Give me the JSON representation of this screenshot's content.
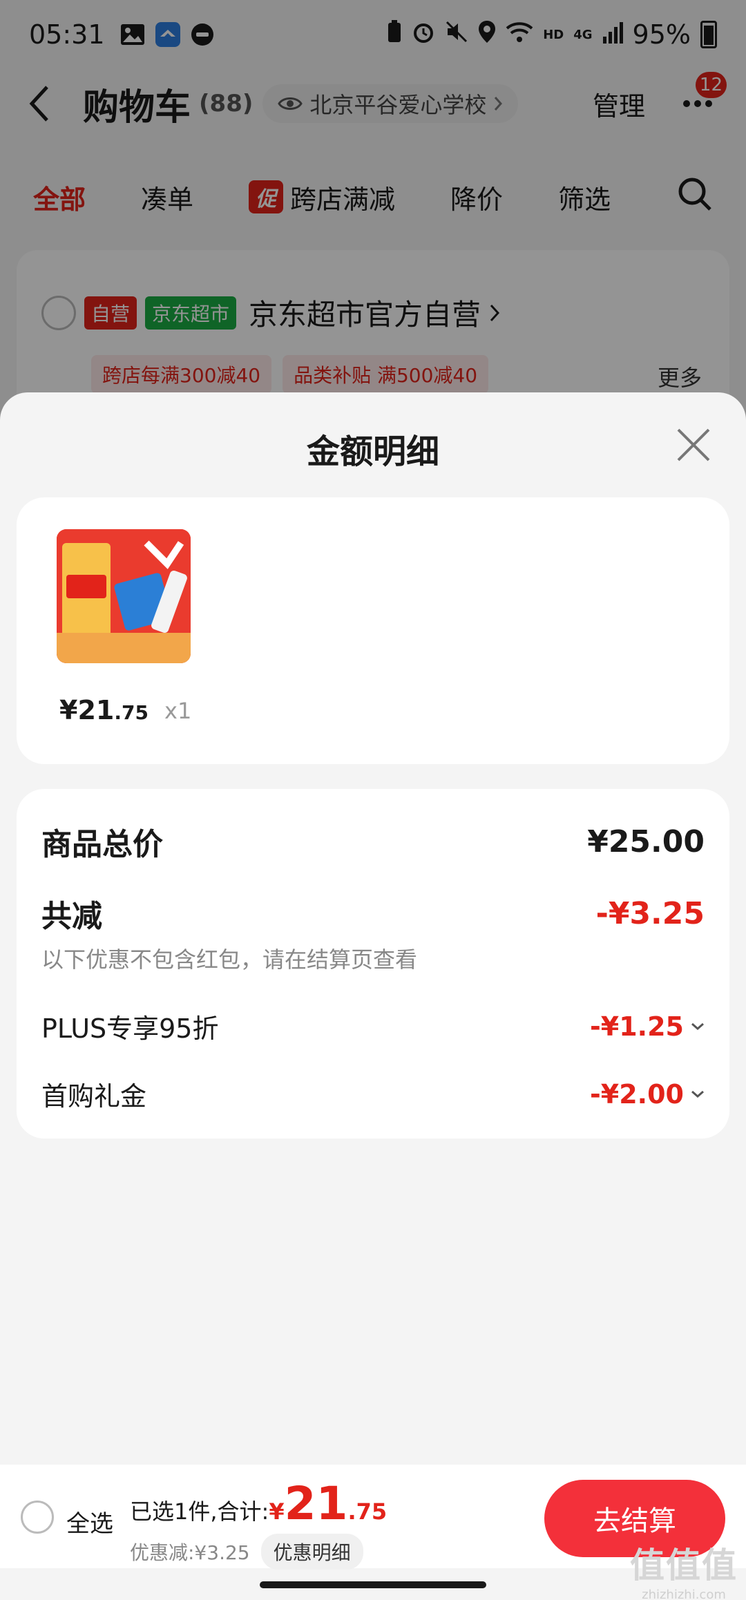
{
  "status_bar": {
    "time": "05:31",
    "network": "HD",
    "signal_label": "4G",
    "battery": "95%"
  },
  "header": {
    "title": "购物车",
    "count": "(88)",
    "location": "北京平谷爱心学校",
    "manage": "管理",
    "badge": "12"
  },
  "tabs": [
    {
      "label": "全部",
      "active": true
    },
    {
      "label": "凑单"
    },
    {
      "label": "跨店满减",
      "tag": "促"
    },
    {
      "label": "降价"
    },
    {
      "label": "筛选"
    }
  ],
  "store": {
    "tag_self": "自营",
    "tag_market": "京东超市",
    "name": "京东超市官方自营",
    "promo1": "跨店每满300减40",
    "promo2": "品类补贴 满500减40",
    "more": "更多"
  },
  "sheet": {
    "title": "金额明细",
    "product": {
      "price_int": "¥21",
      "price_dec": ".75",
      "qty": "x1"
    },
    "rows": {
      "subtotal_label": "商品总价",
      "subtotal_value": "¥25.00",
      "discount_label": "共减",
      "discount_value": "-¥3.25",
      "note": "以下优惠不包含红包，请在结算页查看",
      "plus_label": "PLUS专享95折",
      "plus_value": "-¥1.25",
      "gift_label": "首购礼金",
      "gift_value": "-¥2.00"
    }
  },
  "bottom": {
    "select_all": "全选",
    "summary": "已选1件,合计:",
    "total_cur": "¥",
    "total_int": "21",
    "total_dec": ".75",
    "discount": "优惠减:¥3.25",
    "detail_chip": "优惠明细",
    "checkout": "去结算"
  },
  "watermark": {
    "logo": "值值值",
    "url": "zhizhizhi.com"
  },
  "colors": {
    "accent": "#e2231a",
    "checkout": "#f3303a",
    "green_tag": "#1aad44"
  }
}
